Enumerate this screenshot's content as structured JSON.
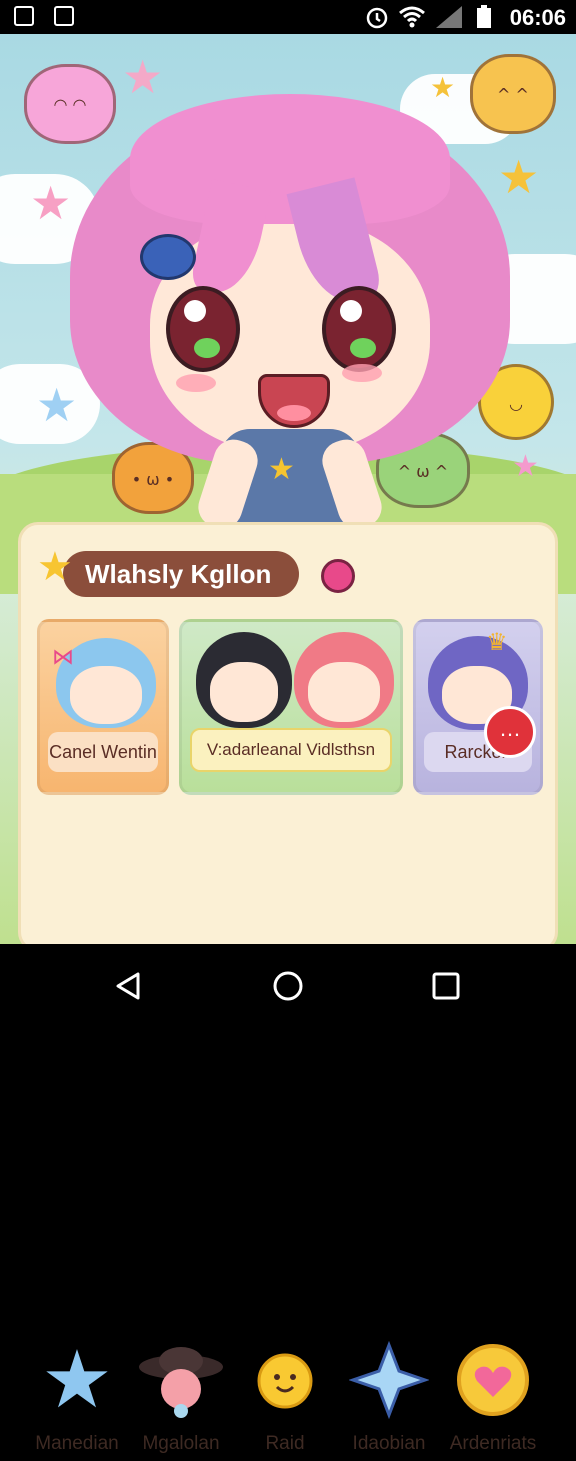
{
  "status_bar": {
    "time": "06:06",
    "left_icons": [
      "image-icon",
      "smiley-notification-icon"
    ],
    "right_icons": [
      "alarm-icon",
      "wifi-icon",
      "signal-icon",
      "battery-icon"
    ]
  },
  "panel": {
    "title": "Wlahsly Kgllon",
    "cards": [
      {
        "label": "Canel Wentin",
        "accent": "#f7b56f"
      },
      {
        "label": "V:adarleanal Vidlsthsn",
        "accent": "#b9df9a"
      },
      {
        "label": "Rarcken",
        "accent": "#b8b3de"
      }
    ],
    "menu": [
      {
        "label": "Manedian",
        "icon": "blue-star-icon"
      },
      {
        "label": "Mgalolan",
        "icon": "hat-icon"
      },
      {
        "label": "Raid",
        "icon": "sun-face-icon"
      },
      {
        "label": "Idaobian",
        "icon": "sparkle-star-icon"
      },
      {
        "label": "Ardenriats",
        "icon": "heart-icon"
      }
    ]
  },
  "nav_bar": {
    "buttons": [
      "back-icon",
      "home-icon",
      "recents-icon"
    ]
  },
  "colors": {
    "title_pill": "#8b4e3b",
    "panel_bg": "#fbf0d5",
    "hair": "#e88ac9"
  }
}
